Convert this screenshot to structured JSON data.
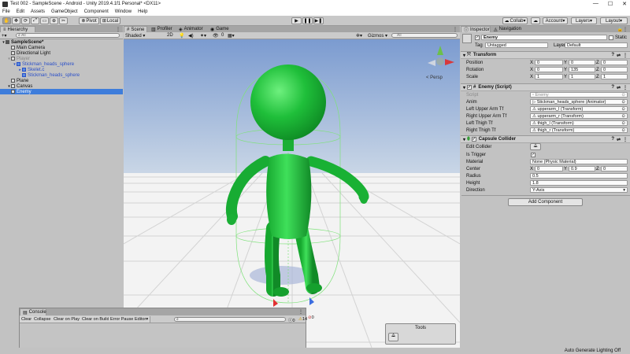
{
  "window": {
    "title": "Test 002 - SampleScene - Android - Unity 2019.4.1f1 Personal* <DX11>"
  },
  "menu": [
    "File",
    "Edit",
    "Assets",
    "GameObject",
    "Component",
    "Window",
    "Help"
  ],
  "toolbar": {
    "pivot": "Pivot",
    "local": "Local",
    "collab": "Collab",
    "account": "Account",
    "layers": "Layers",
    "layout": "Layout"
  },
  "hierarchy": {
    "tab": "Hierarchy",
    "search_placeholder": "All",
    "rows": [
      {
        "label": "SampleScene*",
        "indent": 0,
        "type": "scene"
      },
      {
        "label": "Main Camera",
        "indent": 1,
        "type": "object"
      },
      {
        "label": "Directional Light",
        "indent": 1,
        "type": "object"
      },
      {
        "label": "Player",
        "indent": 1,
        "type": "inactive"
      },
      {
        "label": "Stickman_heads_sphere",
        "indent": 2,
        "type": "prefab"
      },
      {
        "label": "Skelet.c",
        "indent": 3,
        "type": "prefab"
      },
      {
        "label": "Stickman_heads_sphere",
        "indent": 3,
        "type": "prefab"
      },
      {
        "label": "Plane",
        "indent": 1,
        "type": "object"
      },
      {
        "label": "Canvas",
        "indent": 1,
        "type": "object"
      },
      {
        "label": "Enemy",
        "indent": 1,
        "type": "selected"
      }
    ]
  },
  "scene": {
    "tabs": [
      "Scene",
      "Profiler",
      "Animator",
      "Game"
    ],
    "shading": "Shaded",
    "mode_2d": "2D",
    "gizmos": "Gizmos",
    "search_placeholder": "All",
    "hidden_count": "0",
    "perspective": "< Persp"
  },
  "inspector": {
    "tabs": [
      "Inspector",
      "Navigation"
    ],
    "object_name": "Enemy",
    "static_label": "Static",
    "tag_label": "Tag",
    "tag_value": "Untagged",
    "layer_label": "Layer",
    "layer_value": "Default",
    "transform": {
      "title": "Transform",
      "position": {
        "label": "Position",
        "x": "0",
        "y": "0",
        "z": "0"
      },
      "rotation": {
        "label": "Rotation",
        "x": "0",
        "y": "135",
        "z": "0"
      },
      "scale": {
        "label": "Scale",
        "x": "1",
        "y": "1",
        "z": "1"
      }
    },
    "enemy_script": {
      "title": "Enemy (Script)",
      "fields": [
        {
          "label": "Script",
          "value": "Enemy"
        },
        {
          "label": "Anim",
          "value": "Stickman_heads_sphere (Animator)"
        },
        {
          "label": "Left Upper Arm Tf",
          "value": "upperarm_l (Transform)"
        },
        {
          "label": "Right Upper Arm Tf",
          "value": "upperarm_r (Transform)"
        },
        {
          "label": "Left Thigh Tf",
          "value": "thigh_l (Transform)"
        },
        {
          "label": "Right Thigh Tf",
          "value": "thigh_r (Transform)"
        }
      ]
    },
    "capsule": {
      "title": "Capsule Collider",
      "edit_collider": "Edit Collider",
      "is_trigger": "Is Trigger",
      "material_label": "Material",
      "material_value": "None (Physic Material)",
      "center_label": "Center",
      "center": {
        "x": "0",
        "y": "0.9",
        "z": "0"
      },
      "radius_label": "Radius",
      "radius": "0.5",
      "height_label": "Height",
      "height": "1.8",
      "direction_label": "Direction",
      "direction": "Y-Axis"
    },
    "add_component": "Add Component"
  },
  "console": {
    "tab": "Console",
    "buttons": [
      "Clear",
      "Collapse",
      "Clear on Play",
      "Clear on Build",
      "Error Pause",
      "Editor"
    ],
    "counts": {
      "log": "0",
      "warn": "14",
      "error": "0"
    }
  },
  "tools": {
    "title": "Tools"
  },
  "status": {
    "text": "Auto Generate Lighting Off"
  },
  "colors": {
    "stickman": "#1fbf3a",
    "selection": "#3e7ddb",
    "sky_top": "#7b9bd0"
  }
}
